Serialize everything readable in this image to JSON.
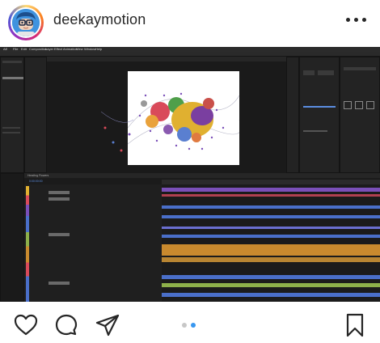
{
  "post": {
    "username": "deekaymotion",
    "more_icon": "more-horizontal-icon",
    "avatar_icon": "avatar-illustration"
  },
  "screenshot": {
    "app": "Adobe After Effects",
    "menu_items": [
      "AE",
      "File",
      "Edit",
      "Composition",
      "Layer",
      "Effect",
      "Animation",
      "View",
      "Window",
      "Help"
    ],
    "timeline_tab_label": "Heading Flowers",
    "timecode": "0:00:00:00",
    "colors": {
      "bg": "#1e1e1e",
      "panel": "#232323",
      "accent_blue": "#5b8de0",
      "track_orange": "#c98a2e",
      "track_blue": "#4a6fc9",
      "track_purple": "#7a4fb8",
      "track_green": "#8db04a",
      "track_red": "#b04050"
    }
  },
  "actions": {
    "like_icon": "heart-icon",
    "comment_icon": "comment-icon",
    "share_icon": "send-icon",
    "save_icon": "bookmark-icon"
  },
  "carousel": {
    "total": 2,
    "active": 2
  }
}
